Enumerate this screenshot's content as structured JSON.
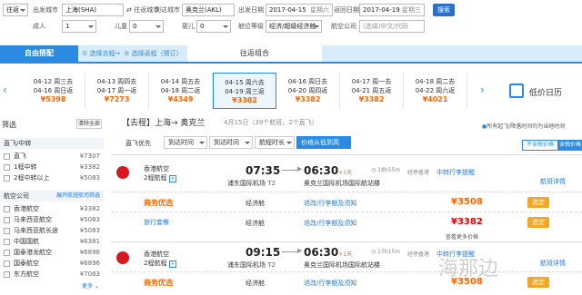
{
  "search": {
    "trip_type": "往返",
    "from_label": "出发城市",
    "from_value": "上海(SHA)",
    "swap_label": "往返城市",
    "to_label": "到达城市",
    "to_value": "奥克兰(AKL)",
    "depart_label": "出发日期",
    "depart_value": "2017-04-15",
    "depart_day": "星期六",
    "return_label": "返回日期",
    "return_value": "2017-04-19",
    "return_day": "星期三",
    "search_button": "搜索",
    "adult_label": "成人",
    "adult_value": "1",
    "child_label": "儿童",
    "child_value": "0",
    "infant_label": "婴儿",
    "infant_value": "0",
    "cabin_label": "舱位等级",
    "cabin_value": "经济/超级经济舱",
    "airline_label": "航空公司",
    "airline_placeholder": "(选填)中文/代码"
  },
  "tabs": {
    "free": "自由搭配",
    "step1": "① 选择去程",
    "step2": "② 选择返程（预订）",
    "roundtrip": "往返组合"
  },
  "date_strip": [
    {
      "d1": "04-12 周三去",
      "d2": "04-16 周日返",
      "price": "¥5398"
    },
    {
      "d1": "04-13 周四去",
      "d2": "04-17 周一返",
      "price": "¥7273"
    },
    {
      "d1": "04-14 周五去",
      "d2": "04-18 周二返",
      "price": "¥4349"
    },
    {
      "d1": "04-15 周六去",
      "d2": "04-19 周三返",
      "price": "¥3382"
    },
    {
      "d1": "04-16 周日去",
      "d2": "04-20 周四返",
      "price": "¥3382"
    },
    {
      "d1": "04-17 周一去",
      "d2": "04-21 周五返",
      "price": "¥3382"
    },
    {
      "d1": "04-18 周二去",
      "d2": "04-22 周六返",
      "price": "¥4021"
    }
  ],
  "low_price_calendar": "低价日历",
  "sidebar": {
    "title": "筛选",
    "clear": "清除全部",
    "direct_section": "直飞/中转",
    "direct": [
      {
        "label": "直飞",
        "price": "¥7307"
      },
      {
        "label": "1程中转",
        "price": "¥3382"
      },
      {
        "label": "2程中转以上",
        "price": "¥5083"
      }
    ],
    "airline_section": "航空公司",
    "airline_more": "展开航班航司筛选",
    "airlines": [
      {
        "label": "香港航空",
        "price": "¥3382"
      },
      {
        "label": "马来西亚航空",
        "price": "¥5083"
      },
      {
        "label": "马来西亚航长途",
        "price": "¥5083"
      },
      {
        "label": "中国国航",
        "price": "¥6381"
      },
      {
        "label": "国泰港龙航空",
        "price": "¥6896"
      },
      {
        "label": "国泰航空",
        "price": "¥6896"
      },
      {
        "label": "东方航空",
        "price": "¥7083"
      }
    ],
    "more": "更多"
  },
  "header": {
    "trip": "【去程】上海→ 奥克兰",
    "summary": "4月15日（39个航班，2个直飞）",
    "notice": "所有起飞/降落时间均为当地时间"
  },
  "toolbar": {
    "direct_first": "直飞优先",
    "depart_time": "到达时间",
    "arrive_time": "到达时间",
    "duration": "航程时长",
    "price_sort": "价格从低到高",
    "tax_excl": "不含税价格",
    "tax_incl": "含税价格"
  },
  "flights": [
    {
      "airline": "香港航空",
      "stops": "2程航程",
      "dep_time": "07:35",
      "dep_airport": "浦东国际机场",
      "terminal": "T2",
      "arr_time": "06:30",
      "plus_day": "+1天",
      "arr_airport": "奥克兰国际机场",
      "arr_terminal": "国际航站楼",
      "duration": "18h55m",
      "via": "经停香港",
      "tag": "中转行李提醒",
      "detail": "航班详情",
      "fares": [
        {
          "name": "商务优选",
          "cabin": "经济舱",
          "rule": "退改/行李额及须知",
          "price": "¥3508",
          "book": "选定"
        },
        {
          "name": "旅行套餐",
          "cabin": "经济舱",
          "rule": "退改/行李额及须知",
          "price": "¥3382",
          "book": "选定"
        }
      ],
      "more_fares": "查看更多价格"
    },
    {
      "airline": "香港航空",
      "stops": "2程航程",
      "dep_time": "09:15",
      "dep_airport": "浦东国际机场",
      "terminal": "T2",
      "arr_time": "06:30",
      "plus_day": "+1天",
      "arr_airport": "奥克兰国际机场",
      "arr_terminal": "国际航站楼",
      "duration": "17h15m",
      "via": "经停香港",
      "tag": "中转行李提醒",
      "detail": "航班详情",
      "fares": [
        {
          "name": "商务优选",
          "cabin": "经济舱",
          "rule": "退改/行李额及须知",
          "price": "¥3508",
          "book": "选定"
        }
      ]
    }
  ],
  "watermark": "海那边",
  "colors": {
    "accent": "#2a8be0",
    "price": "#ff6600",
    "book": "#f6a623",
    "airline_red": "#d7191f"
  }
}
